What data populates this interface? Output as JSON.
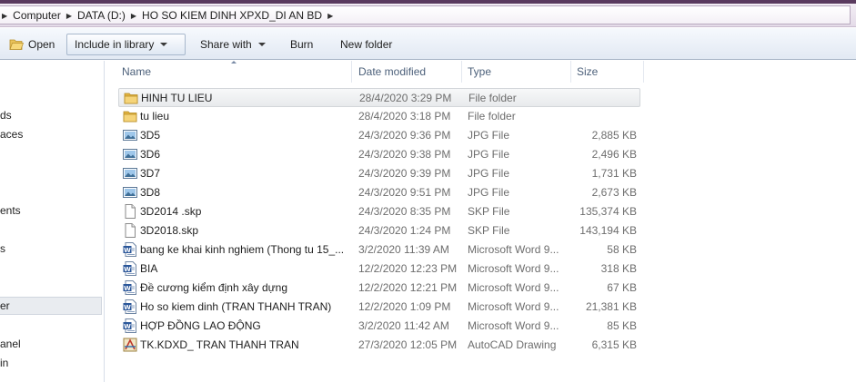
{
  "address": {
    "crumbs": [
      "Computer",
      "DATA (D:)",
      "HO SO KIEM DINH XPXD_DI AN BD"
    ]
  },
  "toolbar": {
    "open": "Open",
    "include_library": "Include in library",
    "share_with": "Share with",
    "burn": "Burn",
    "new_folder": "New folder"
  },
  "nav": {
    "items": [
      "ds",
      "aces",
      "ents",
      "s",
      "er",
      "anel",
      "in"
    ],
    "selected_index": 4
  },
  "columns": {
    "name": "Name",
    "date": "Date modified",
    "type": "Type",
    "size": "Size"
  },
  "files": [
    {
      "icon": "folder-icon",
      "name": "HINH TU LIEU",
      "date": "28/4/2020 3:29 PM",
      "type": "File folder",
      "size": "",
      "selected": true
    },
    {
      "icon": "folder-icon",
      "name": "tu lieu",
      "date": "28/4/2020 3:18 PM",
      "type": "File folder",
      "size": ""
    },
    {
      "icon": "image-file-icon",
      "name": "3D5",
      "date": "24/3/2020 9:36 PM",
      "type": "JPG File",
      "size": "2,885 KB"
    },
    {
      "icon": "image-file-icon",
      "name": "3D6",
      "date": "24/3/2020 9:38 PM",
      "type": "JPG File",
      "size": "2,496 KB"
    },
    {
      "icon": "image-file-icon",
      "name": "3D7",
      "date": "24/3/2020 9:39 PM",
      "type": "JPG File",
      "size": "1,731 KB"
    },
    {
      "icon": "image-file-icon",
      "name": "3D8",
      "date": "24/3/2020 9:51 PM",
      "type": "JPG File",
      "size": "2,673 KB"
    },
    {
      "icon": "blank-file-icon",
      "name": "3D2014 .skp",
      "date": "24/3/2020 8:35 PM",
      "type": "SKP File",
      "size": "135,374 KB"
    },
    {
      "icon": "blank-file-icon",
      "name": "3D2018.skp",
      "date": "24/3/2020 1:24 PM",
      "type": "SKP File",
      "size": "143,194 KB"
    },
    {
      "icon": "word-file-icon",
      "name": "bang ke khai kinh nghiem  (Thong tu 15_...",
      "date": "3/2/2020 11:39 AM",
      "type": "Microsoft Word 9...",
      "size": "58 KB"
    },
    {
      "icon": "word-file-icon",
      "name": "BIA",
      "date": "12/2/2020 12:23 PM",
      "type": "Microsoft Word 9...",
      "size": "318 KB"
    },
    {
      "icon": "word-file-icon",
      "name": "Đề cương kiểm định xây dựng",
      "date": "12/2/2020 12:21 PM",
      "type": "Microsoft Word 9...",
      "size": "67 KB"
    },
    {
      "icon": "word-file-icon",
      "name": "Ho so kiem dinh (TRAN THANH TRAN)",
      "date": "12/2/2020 1:09 PM",
      "type": "Microsoft Word 9...",
      "size": "21,381 KB"
    },
    {
      "icon": "word-file-icon",
      "name": "HỢP ĐỒNG LAO ĐỘNG",
      "date": "3/2/2020 11:42 AM",
      "type": "Microsoft Word 9...",
      "size": "85 KB"
    },
    {
      "icon": "autocad-file-icon",
      "name": "TK.KDXD_ TRAN THANH TRAN",
      "date": "27/3/2020 12:05 PM",
      "type": "AutoCAD Drawing",
      "size": "6,315 KB"
    }
  ]
}
